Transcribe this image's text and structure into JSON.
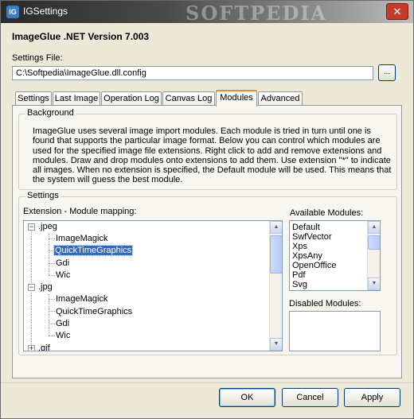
{
  "window": {
    "title": "IGSettings",
    "watermark": "SOFTPEDIA",
    "close_glyph": "✕"
  },
  "header": {
    "version": "ImageGlue .NET Version 7.003",
    "settings_file_label": "Settings File:",
    "settings_file_value": "C:\\Softpedia\\ImageGlue.dll.config",
    "browse_label": "..."
  },
  "tabs": [
    {
      "label": "Settings",
      "active": false
    },
    {
      "label": "Last Image",
      "active": false
    },
    {
      "label": "Operation Log",
      "active": false
    },
    {
      "label": "Canvas Log",
      "active": false
    },
    {
      "label": "Modules",
      "active": true
    },
    {
      "label": "Advanced",
      "active": false
    }
  ],
  "background": {
    "title": "Background",
    "text": "ImageGlue uses several image import modules. Each module is tried in turn until one is found that supports the particular image format. Below you can control which modules are used for the specified image file extensions.  Right click to add and remove extensions and modules. Draw and drop modules onto extensions to add them. Use extension \"*\" to indicate all images. When no extension is specified, the Default module will be used. This means that the system will guess the best module."
  },
  "settings_group": {
    "title": "Settings",
    "mapping_label": "Extension - Module mapping:",
    "tree": [
      {
        "label": ".jpeg",
        "level": 0,
        "expander": "−"
      },
      {
        "label": "ImageMagick",
        "level": 1
      },
      {
        "label": "QuickTimeGraphics",
        "level": 1,
        "selected": true
      },
      {
        "label": "Gdi",
        "level": 1
      },
      {
        "label": "Wic",
        "level": 1
      },
      {
        "label": ".jpg",
        "level": 0,
        "expander": "−"
      },
      {
        "label": "ImageMagick",
        "level": 1
      },
      {
        "label": "QuickTimeGraphics",
        "level": 1
      },
      {
        "label": "Gdi",
        "level": 1
      },
      {
        "label": "Wic",
        "level": 1
      },
      {
        "label": ".gif",
        "level": 0,
        "expander": "+"
      }
    ],
    "available_label": "Available Modules:",
    "available_modules": [
      "Default",
      "SwfVector",
      "Xps",
      "XpsAny",
      "OpenOffice",
      "Pdf",
      "Svg"
    ],
    "disabled_label": "Disabled Modules:",
    "disabled_modules": []
  },
  "footer": {
    "ok_label": "OK",
    "cancel_label": "Cancel",
    "apply_label": "Apply"
  },
  "colors": {
    "selection": "#316ac5",
    "active_tab_accent": "#e68b2c",
    "dialog_bg": "#ece9d8"
  },
  "icons": {
    "app": "imageglue-app-icon",
    "close": "close-icon",
    "scroll_up": "scroll-up-arrow-icon",
    "scroll_down": "scroll-down-arrow-icon"
  }
}
